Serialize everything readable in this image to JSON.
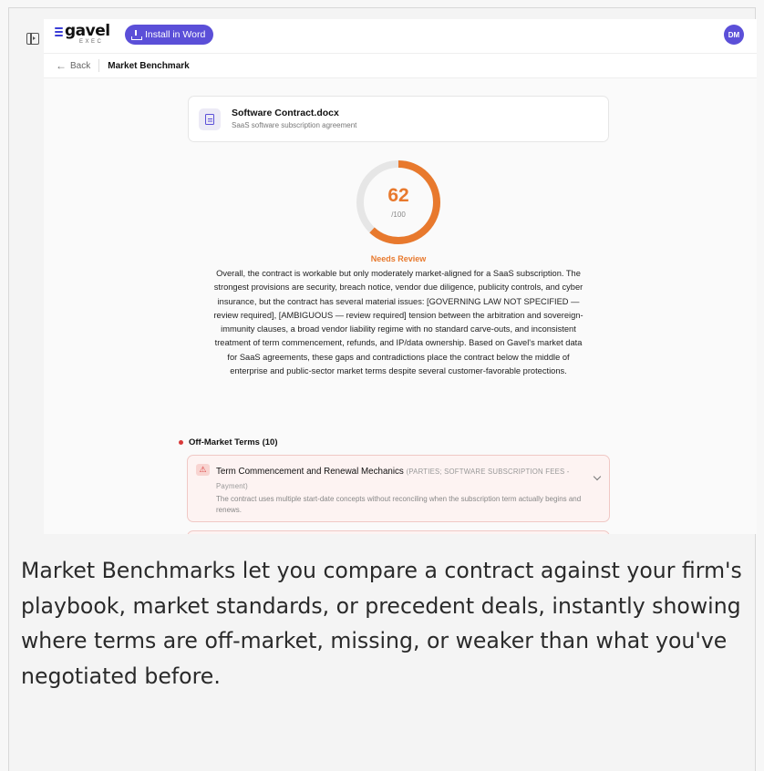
{
  "topbar": {
    "logo_text": "gavel",
    "logo_sub": "EXEC",
    "install_label": "Install in Word",
    "avatar_initials": "DM"
  },
  "breadcrumb": {
    "back_label": "Back",
    "title": "Market Benchmark"
  },
  "document": {
    "name": "Software Contract.docx",
    "description": "SaaS software subscription agreement"
  },
  "score": {
    "value": "62",
    "max": "/100",
    "percent": 62,
    "status": "Needs Review"
  },
  "summary": "Overall, the contract is workable but only moderately market-aligned for a SaaS subscription. The strongest provisions are security, breach notice, vendor due diligence, publicity controls, and cyber insurance, but the contract has several material issues: [GOVERNING LAW NOT SPECIFIED — review required], [AMBIGUOUS — review required] tension between the arbitration and sovereign-immunity clauses, a broad vendor liability regime with no standard carve-outs, and inconsistent treatment of term commencement, refunds, and IP/data ownership. Based on Gavel's market data for SaaS agreements, these gaps and contradictions place the contract below the middle of enterprise and public-sector market terms despite several customer-favorable protections.",
  "off_market": {
    "heading": "Off-Market Terms (10)",
    "items": [
      {
        "title": "Term Commencement and Renewal Mechanics",
        "reference": "(PARTIES; SOFTWARE SUBSCRIPTION FEES - Payment)",
        "description": "The contract uses multiple start-date concepts without reconciling when the subscription term actually begins and renews."
      }
    ]
  },
  "caption": "Market Benchmarks let you compare a contract against your firm's playbook, market standards, or precedent deals, instantly showing where terms are off-market, missing, or weaker than what you've negotiated before.",
  "colors": {
    "accent": "#5b4fd8",
    "score_orange": "#e8792d",
    "alert_red": "#d93a3a"
  }
}
